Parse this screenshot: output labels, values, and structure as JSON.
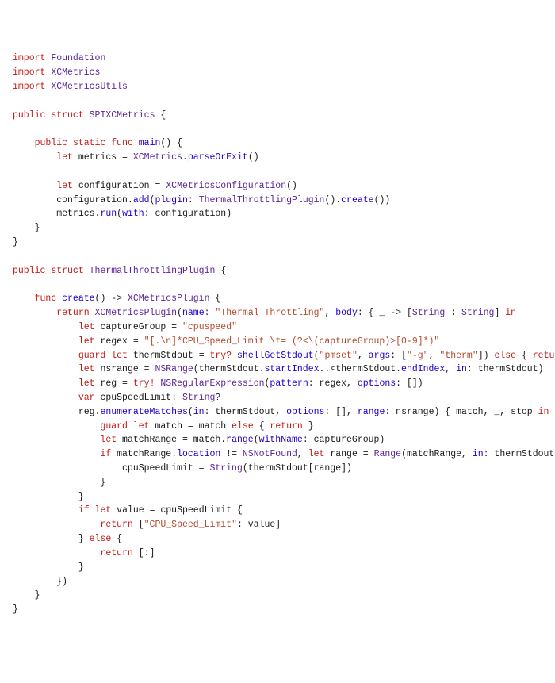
{
  "code": {
    "l1": {
      "kw1": "import",
      "t1": "Foundation"
    },
    "l2": {
      "kw1": "import",
      "t1": "XCMetrics"
    },
    "l3": {
      "kw1": "import",
      "t1": "XCMetricsUtils"
    },
    "l5": {
      "kw1": "public",
      "kw2": "struct",
      "t1": "SPTXCMetrics",
      "p": " {"
    },
    "l7": {
      "pad": "    ",
      "kw1": "public",
      "kw2": "static",
      "kw3": "func",
      "m": "main",
      "p": "() {"
    },
    "l8": {
      "pad": "        ",
      "kw1": "let",
      "id": "metrics = ",
      "t1": "XCMetrics",
      "p1": ".",
      "m": "parseOrExit",
      "p2": "()"
    },
    "l10": {
      "pad": "        ",
      "kw1": "let",
      "id": "configuration = ",
      "t1": "XCMetricsConfiguration",
      "p": "()"
    },
    "l11": {
      "pad": "        ",
      "id": "configuration.",
      "m1": "add",
      "p1": "(",
      "m2": "plugin",
      "p2": ": ",
      "t1": "ThermalThrottlingPlugin",
      "p3": "().",
      "m3": "create",
      "p4": "())"
    },
    "l12": {
      "pad": "        ",
      "id": "metrics.",
      "m1": "run",
      "p1": "(",
      "m2": "with",
      "p2": ": configuration)"
    },
    "l13": {
      "pad": "    ",
      "p": "}"
    },
    "l14": {
      "p": "}"
    },
    "l16": {
      "kw1": "public",
      "kw2": "struct",
      "t1": "ThermalThrottlingPlugin",
      "p": " {"
    },
    "l18": {
      "pad": "    ",
      "kw1": "func",
      "m": "create",
      "p1": "() -> ",
      "t1": "XCMetricsPlugin",
      "p2": " {"
    },
    "l19": {
      "pad": "        ",
      "kw1": "return",
      "sp": " ",
      "t1": "XCMetricsPlugin",
      "p1": "(",
      "m1": "name",
      "p2": ": ",
      "s1": "\"Thermal Throttling\"",
      "p3": ", ",
      "m2": "body",
      "p4": ": { _ -> [",
      "t2": "String",
      "p5": " : ",
      "t3": "String",
      "p6": "] ",
      "kw2": "in"
    },
    "l20": {
      "pad": "            ",
      "kw1": "let",
      "id": "captureGroup = ",
      "s": "\"cpuspeed\""
    },
    "l21": {
      "pad": "            ",
      "kw1": "let",
      "id": "regex = ",
      "s": "\"[.\\n]*CPU_Speed_Limit \\t= (?<\\(captureGroup)>[0-9]*)\""
    },
    "l22": {
      "pad": "            ",
      "kw1": "guard",
      "kw2": "let",
      "id": "thermStdout = ",
      "kw3": "try?",
      "sp": " ",
      "m": "shellGetStdout",
      "p1": "(",
      "s1": "\"pmset\"",
      "p2": ", ",
      "m2": "args",
      "p3": ": [",
      "s2": "\"-g\"",
      "p4": ", ",
      "s3": "\"therm\"",
      "p5": "]) ",
      "kw4": "else",
      "p6": " { ",
      "kw5": "return",
      "p7": " [:] }"
    },
    "l23": {
      "pad": "            ",
      "kw1": "let",
      "id": "nsrange = ",
      "t1": "NSRange",
      "p1": "(thermStdout.",
      "m1": "startIndex",
      "p2": "..<thermStdout.",
      "m2": "endIndex",
      "p3": ", ",
      "m3": "in",
      "p4": ": thermStdout)"
    },
    "l24": {
      "pad": "            ",
      "kw1": "let",
      "id": "reg = ",
      "kw2": "try!",
      "sp": " ",
      "t1": "NSRegularExpression",
      "p1": "(",
      "m1": "pattern",
      "p2": ": regex, ",
      "m2": "options",
      "p3": ": [])"
    },
    "l25": {
      "pad": "            ",
      "kw1": "var",
      "id": "cpuSpeedLimit: ",
      "t1": "String",
      "p": "?"
    },
    "l26": {
      "pad": "            ",
      "id": "reg.",
      "m1": "enumerateMatches",
      "p1": "(",
      "m2": "in",
      "p2": ": thermStdout, ",
      "m3": "options",
      "p3": ": [], ",
      "m4": "range",
      "p4": ": nsrange) { match, _, stop ",
      "kw1": "in"
    },
    "l27": {
      "pad": "                ",
      "kw1": "guard",
      "kw2": "let",
      "id": "match = match ",
      "kw3": "else",
      "p1": " { ",
      "kw4": "return",
      "p2": " }"
    },
    "l28": {
      "pad": "                ",
      "kw1": "let",
      "id": "matchRange = match.",
      "m1": "range",
      "p1": "(",
      "m2": "withName",
      "p2": ": captureGroup)"
    },
    "l29": {
      "pad": "                ",
      "kw1": "if",
      "id1": " matchRange.",
      "m1": "location",
      "id2": " != ",
      "t1": "NSNotFound",
      "p1": ", ",
      "kw2": "let",
      "id3": "range = ",
      "t2": "Range",
      "p2": "(matchRange, ",
      "m2": "in",
      "p3": ": thermStdout) {"
    },
    "l30": {
      "pad": "                    ",
      "id": "cpuSpeedLimit = ",
      "t1": "String",
      "p": "(thermStdout[range])"
    },
    "l31": {
      "pad": "                ",
      "p": "}"
    },
    "l32": {
      "pad": "            ",
      "p": "}"
    },
    "l33": {
      "pad": "            ",
      "kw1": "if",
      "kw2": "let",
      "id": "value = cpuSpeedLimit {"
    },
    "l34": {
      "pad": "                ",
      "kw1": "return",
      "p1": " [",
      "s": "\"CPU_Speed_Limit\"",
      "p2": ": value]"
    },
    "l35": {
      "pad": "            ",
      "p1": "} ",
      "kw1": "else",
      "p2": " {"
    },
    "l36": {
      "pad": "                ",
      "kw1": "return",
      "p": " [:]"
    },
    "l37": {
      "pad": "            ",
      "p": "}"
    },
    "l38": {
      "pad": "        ",
      "p": "})"
    },
    "l39": {
      "pad": "    ",
      "p": "}"
    },
    "l40": {
      "p": "}"
    }
  }
}
